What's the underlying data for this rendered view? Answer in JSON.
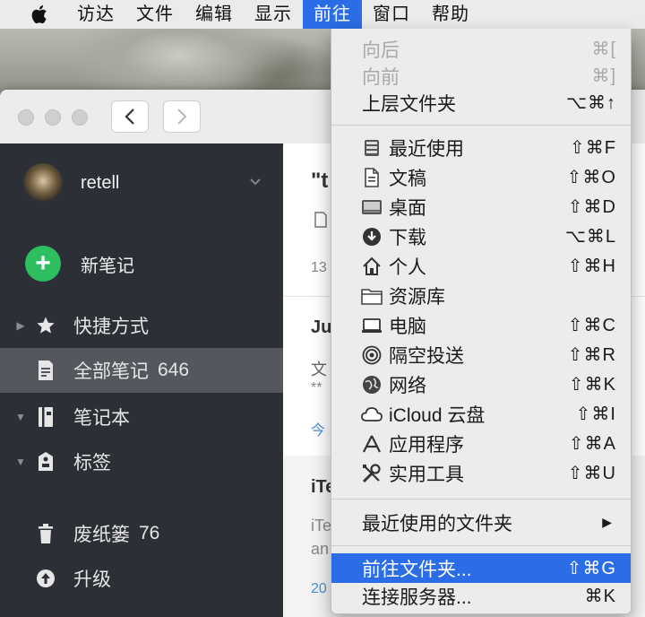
{
  "menubar": {
    "items": [
      "访达",
      "文件",
      "编辑",
      "显示",
      "前往",
      "窗口",
      "帮助"
    ],
    "active": "前往"
  },
  "sidebar": {
    "username": "retell",
    "new_note": "新笔记",
    "rows": [
      {
        "label": "快捷方式",
        "count": "",
        "icon": "star-icon"
      },
      {
        "label": "全部笔记",
        "count": "646",
        "icon": "notes-icon"
      },
      {
        "label": "笔记本",
        "count": "",
        "icon": "notebook-icon"
      },
      {
        "label": "标签",
        "count": "",
        "icon": "tag-icon"
      },
      {
        "label": "废纸篓",
        "count": "76",
        "icon": "trash-icon"
      },
      {
        "label": "升级",
        "count": "",
        "icon": "upgrade-icon"
      }
    ]
  },
  "note_list": {
    "fragments": [
      "\"t",
      "13",
      "Ju",
      "文",
      "**",
      "今",
      "iTe",
      "iTe",
      "an",
      "20"
    ]
  },
  "go_menu": {
    "items": [
      {
        "label": "向后",
        "shortcut": "⌘[",
        "disabled": true
      },
      {
        "label": "向前",
        "shortcut": "⌘]",
        "disabled": true
      },
      {
        "label": "上层文件夹",
        "shortcut": "⌥⌘↑"
      },
      {
        "label": "最近使用",
        "shortcut": "⇧⌘F",
        "icon": "recents-icon"
      },
      {
        "label": "文稿",
        "shortcut": "⇧⌘O",
        "icon": "document-icon"
      },
      {
        "label": "桌面",
        "shortcut": "⇧⌘D",
        "icon": "desktop-icon"
      },
      {
        "label": "下载",
        "shortcut": "⌥⌘L",
        "icon": "download-icon"
      },
      {
        "label": "个人",
        "shortcut": "⇧⌘H",
        "icon": "home-icon"
      },
      {
        "label": "资源库",
        "shortcut": "",
        "icon": "folder-icon"
      },
      {
        "label": "电脑",
        "shortcut": "⇧⌘C",
        "icon": "computer-icon"
      },
      {
        "label": "隔空投送",
        "shortcut": "⇧⌘R",
        "icon": "airdrop-icon"
      },
      {
        "label": "网络",
        "shortcut": "⇧⌘K",
        "icon": "network-icon"
      },
      {
        "label": "iCloud 云盘",
        "shortcut": "⇧⌘I",
        "icon": "icloud-icon"
      },
      {
        "label": "应用程序",
        "shortcut": "⇧⌘A",
        "icon": "applications-icon"
      },
      {
        "label": "实用工具",
        "shortcut": "⇧⌘U",
        "icon": "utilities-icon"
      },
      {
        "label": "最近使用的文件夹",
        "shortcut": "▶"
      },
      {
        "label": "前往文件夹...",
        "shortcut": "⇧⌘G",
        "highlighted": true
      },
      {
        "label": "连接服务器...",
        "shortcut": "⌘K"
      }
    ]
  }
}
